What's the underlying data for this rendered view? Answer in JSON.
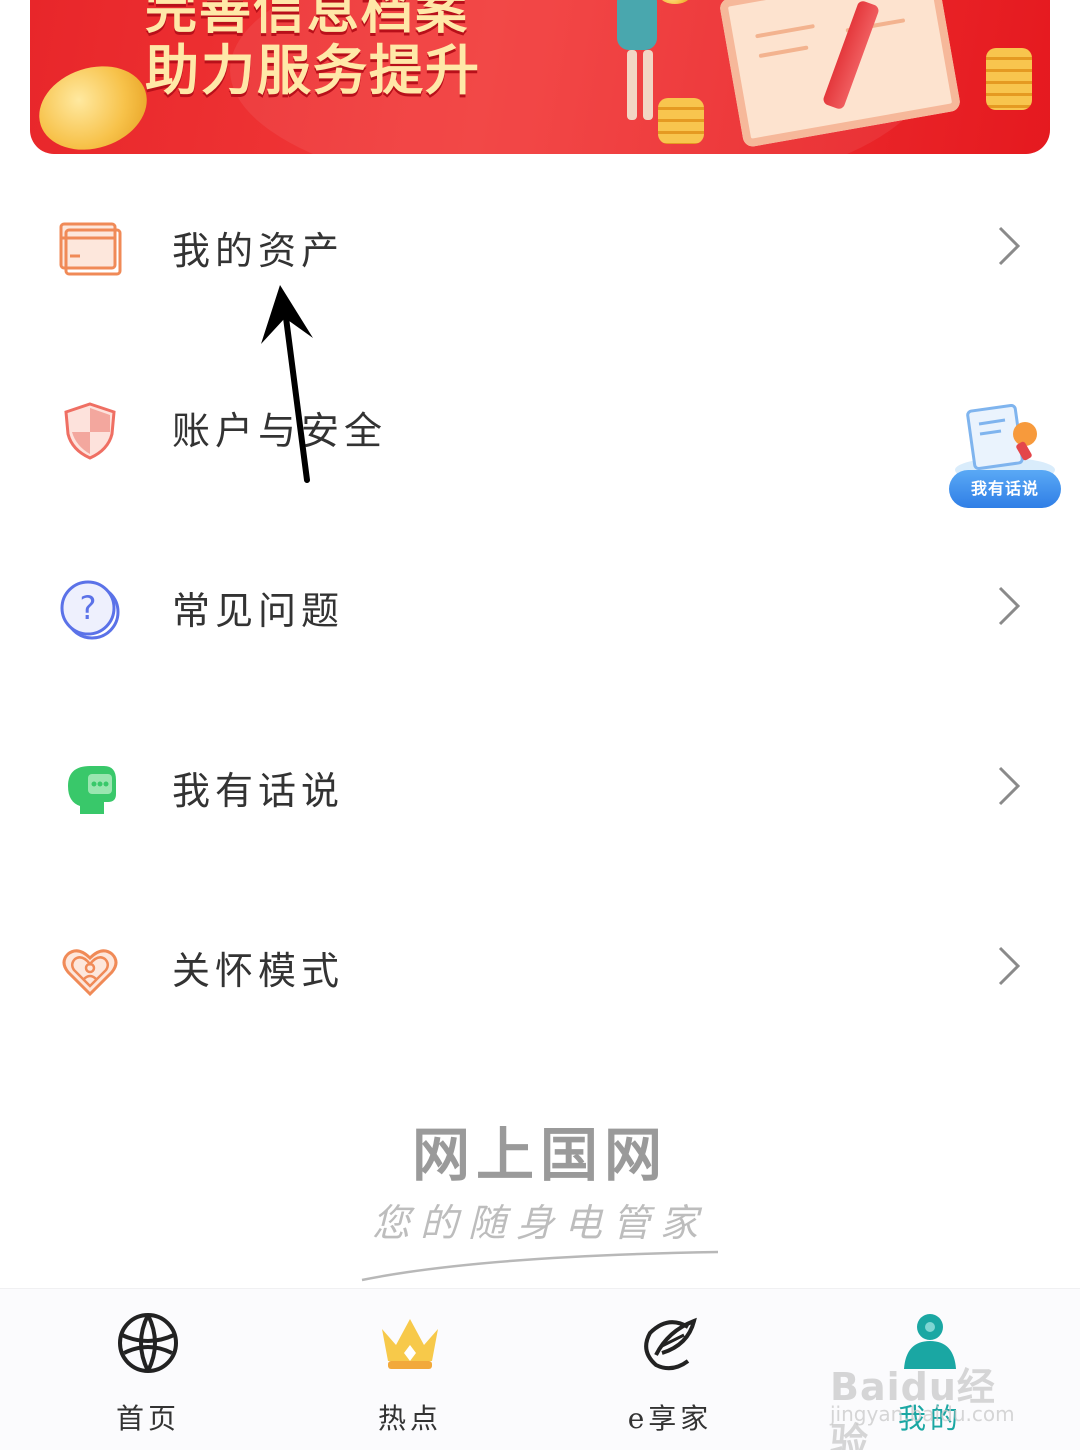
{
  "banner": {
    "line1": "完善信息档案",
    "line2": "助力服务提升"
  },
  "menu": {
    "items": [
      {
        "label": "我的资产",
        "icon": "asset-card-icon",
        "color": "#f08a57"
      },
      {
        "label": "账户与安全",
        "icon": "shield-icon",
        "color": "#ef6f63"
      },
      {
        "label": "常见问题",
        "icon": "question-icon",
        "color": "#5b72e8"
      },
      {
        "label": "我有话说",
        "icon": "chat-head-icon",
        "color": "#39c86a"
      },
      {
        "label": "关怀模式",
        "icon": "heart-care-icon",
        "color": "#f08a57"
      }
    ]
  },
  "floating": {
    "label": "我有话说"
  },
  "brand": {
    "title": "网上国网",
    "slogan": "您的随身电管家"
  },
  "tabbar": {
    "tabs": [
      {
        "label": "首页",
        "icon": "globe-icon",
        "active": false
      },
      {
        "label": "热点",
        "icon": "crown-icon",
        "active": false
      },
      {
        "label": "e享家",
        "icon": "leaf-e-icon",
        "active": false
      },
      {
        "label": "我的",
        "icon": "profile-icon",
        "active": true
      }
    ],
    "active_color": "#1aa7a3"
  },
  "watermark": {
    "main": "Baidu经验",
    "sub": "jingyan.baidu.com"
  },
  "colors": {
    "banner_red": "#e8262a",
    "banner_text": "#ffe8a8",
    "text": "#333333"
  }
}
